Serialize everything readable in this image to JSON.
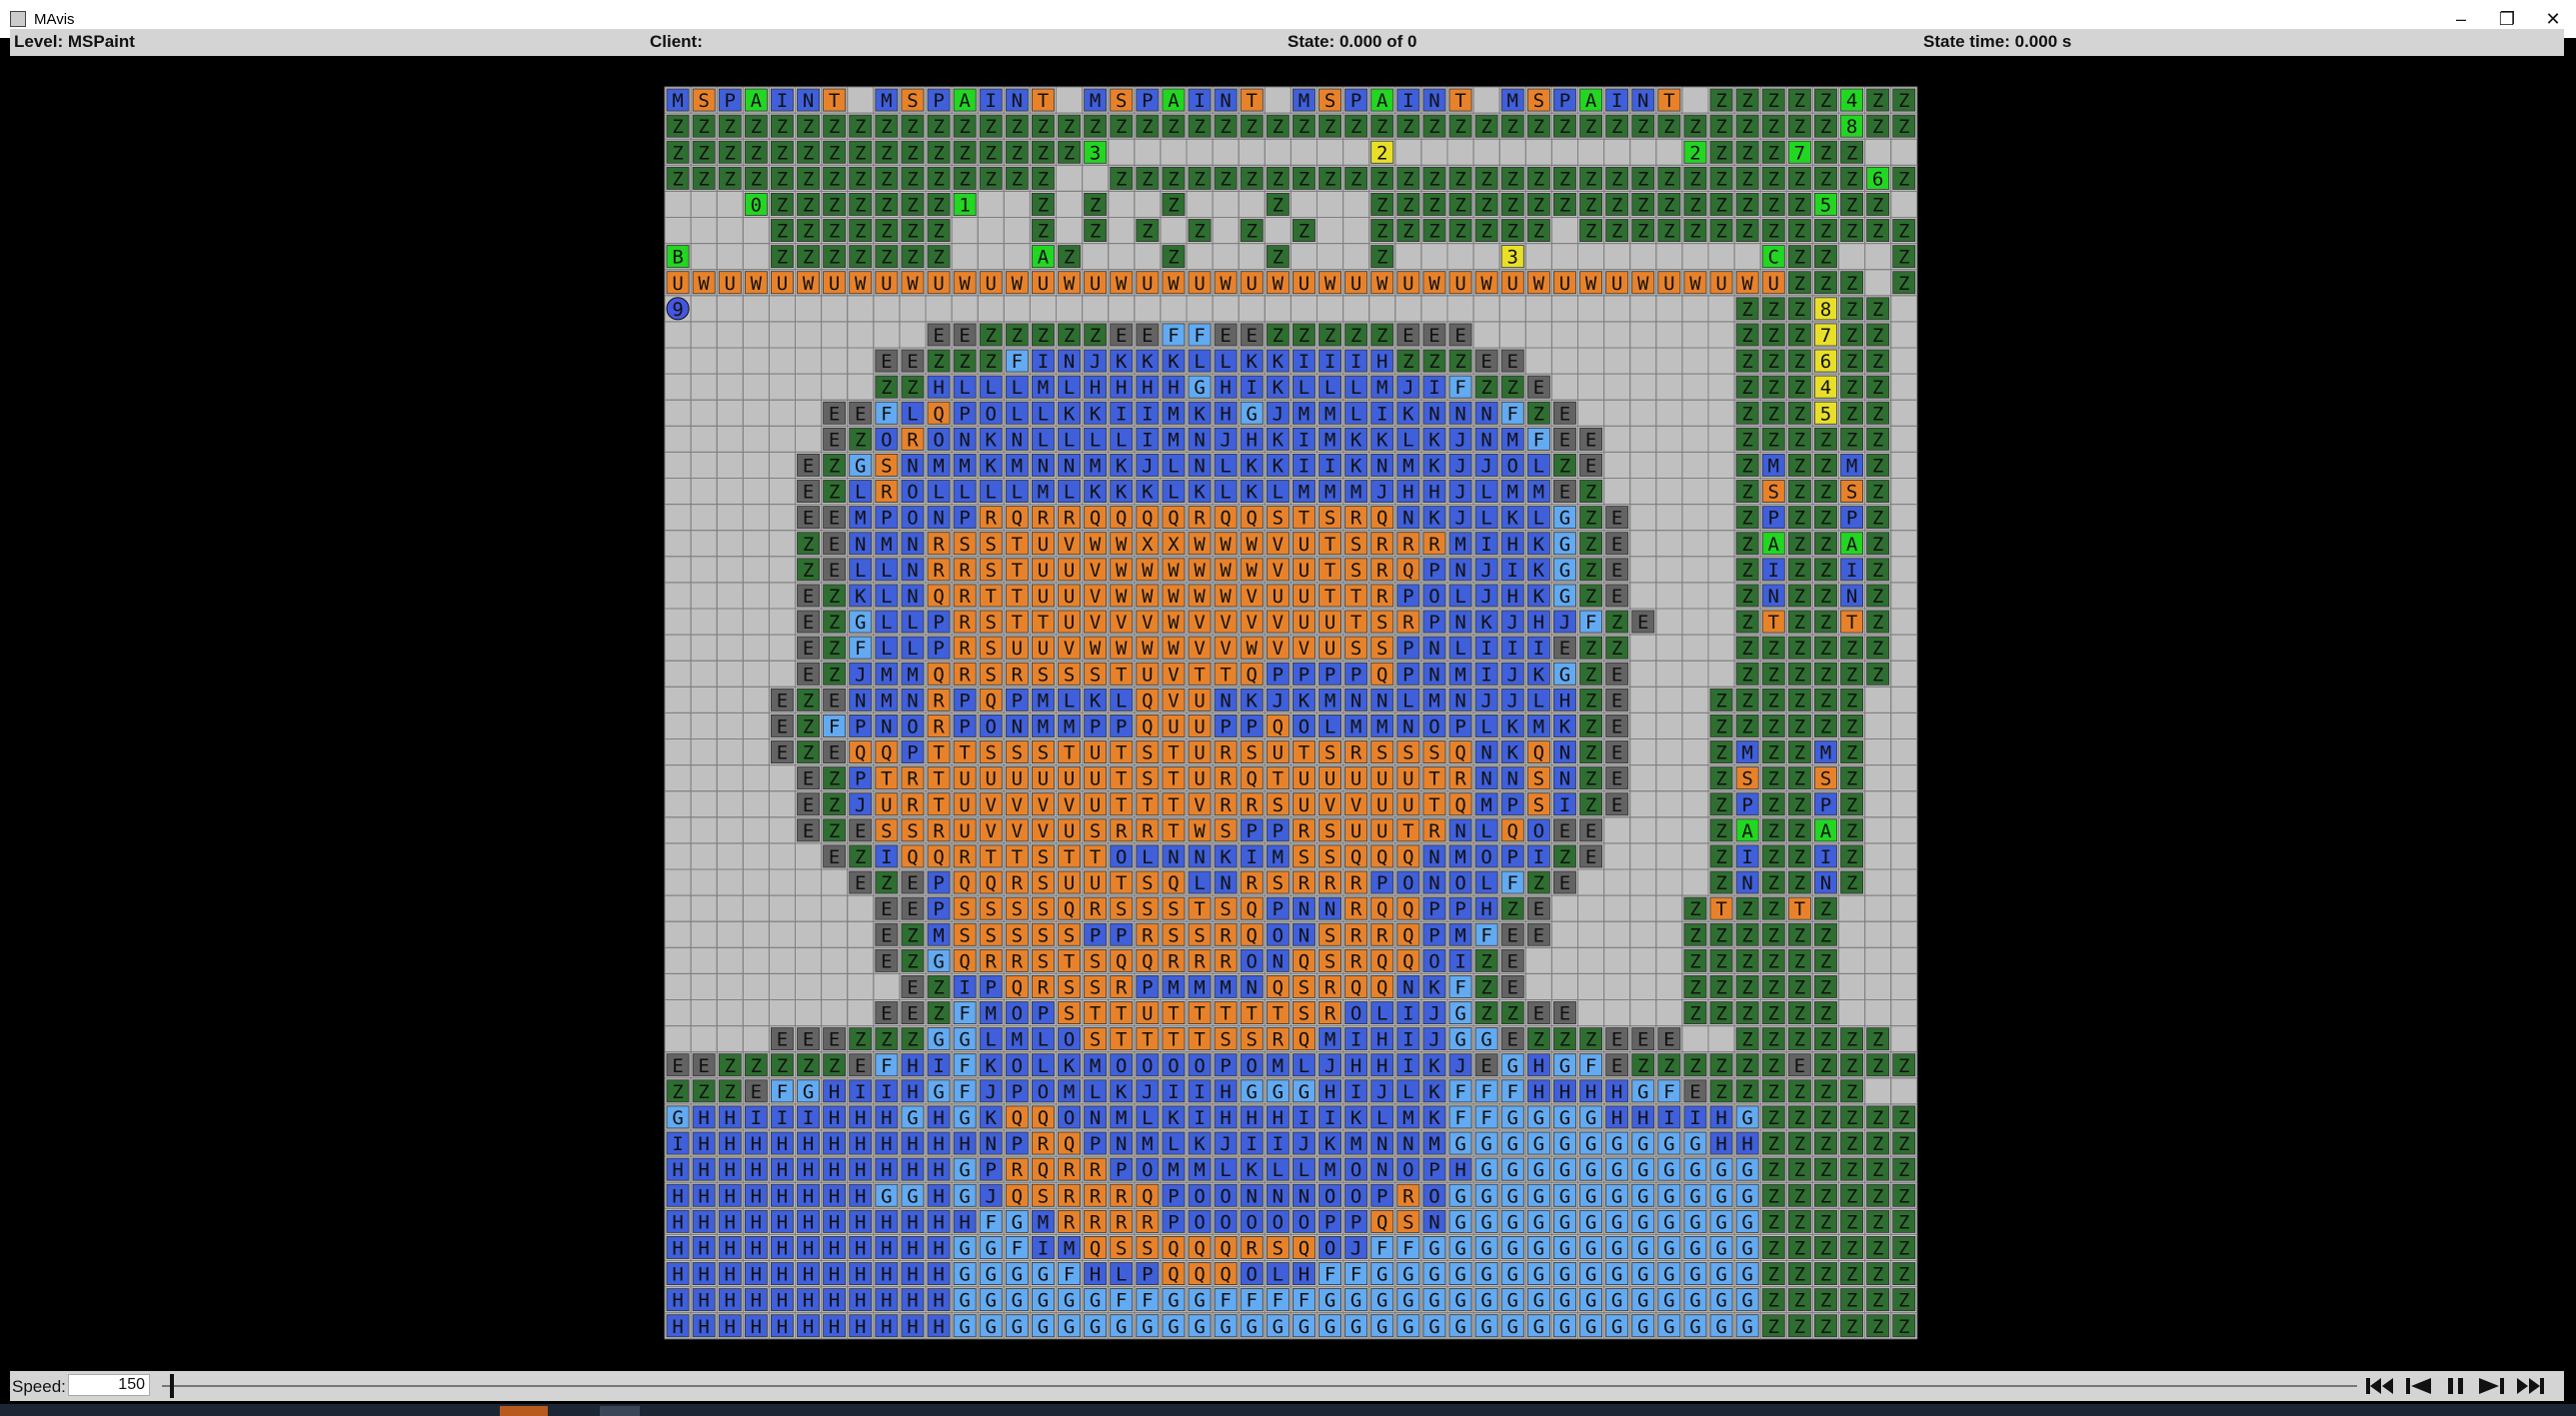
{
  "window": {
    "title": "MAvis"
  },
  "infobar": {
    "level": "Level: MSPaint",
    "client": "Client:",
    "state": "State: 0.000 of 0",
    "state_time": "State time: 0.000 s"
  },
  "bottombar": {
    "speed_label": "Speed:",
    "speed_value": "150"
  },
  "colors": {
    "wall": "#c0c0c0",
    "grid_line": "#808080",
    "dark_box": "#636363",
    "green_box": "#2e6e30",
    "blue_box": "#3f5fdb",
    "orange_box": "#e8822a",
    "light_blue_box": "#62aaf2",
    "agent_green": "#22d622",
    "agent_yellow": "#e8e028",
    "agent_blue": "#4656e0"
  },
  "grid": {
    "rows": [
      "MSPAINT MSPAINT MSPAINT MSPAINT MSPAINT ZZZZZ4ZZ",
      "ZZZZZZZZZZZZZZZZZZZZZZZZZZZZZZZZZZZZZZZZZZZZZ8ZZ",
      "ZZZZZZZZZZZZZZZZ3          2           2ZZZ7ZZ",
      "ZZZZZZZZZZZZZZZ  ZZZZZZZZZZZZZZZZZZZZZZZZZZZZZ6ZZ",
      "   0ZZZZZZZ1  Z Z  Z   Z   ZZZZZZZZZZZZZZZZZ5ZZ",
      "    ZZZZZZZ   Z Z Z Z Z Z  ZZZZZZZ ZZZZZZZZZZZZZ",
      "B   ZZZZZZZ   AZ   Z   Z   Z    3         CZZ  Z",
      "UWUWUWUWUWUWUWUWUWUWUWUWUWUWUWUWUWUWUWUWUWUZZZ ZZ",
      "9                                        ZZZ8ZZ",
      "          EEZZZZZEEFFEEZZZZZEEE          ZZZ7ZZ",
      "        EEZZZFINJKKKLLKKIIIHZZZEE        ZZZ6ZZ",
      "        ZZHLLLMLHHHHGHIKLLLMJIFZZE       ZZZ4ZZ",
      "      EEFLQPOLLKKIIMKHGJMMLIKNNNFZE      ZZZ5ZZ",
      "      EZORONKNLLLLIMNJHKIMKKLKJNMFEE     ZZZZZZ",
      "     EZGSNMMKMNNMKJLNLKKIIKNMKJJOLZE     ZMZZMZ",
      "     EZLROLLLLMLKKKLKLKLMMMJHHJLMMEZ     ZSZZSZ",
      "     EEMPONPRQRRQQQQRQQSTSRQNKJLKLGZE    ZPZZPZ",
      "     ZENMNRSSTUVWWXXWWWVUTSRRRMIHKGZE    ZAZZAZ",
      "     ZELLNRRSTUUVWWWWWWVUTSRQPNJIKGZE    ZIZZIZ",
      "     EZKLNQRTTUUVWWWWWVUUTTRPOLJHKGZE    ZNZZNZ",
      "     EZGLLPRSTTUVVVWVVVVUUTSRPNKJHJFZE   ZTZZTZ",
      "     EZFLLPRSUUVWWWWVVWVVUSSPNLIIIEZZ    ZZZZZZ",
      "     EZJMMQRSRSSSTUVTTQPPPPQPNMIJKGZE    ZZZZZZ",
      "    EZENMNRPQPMLKLQVUNKJKMNNLMNJJLHZE   ZZZZZZ",
      "    EZFPNORPONMMPPQUUPPQOLMMNOPLKMKZE   ZZZZZZ",
      "    EZEQQPTTSSSTUTSTURSUTSRSSSQNKQNZE   ZMZZMZ",
      "     EZPTRTUUUUUUTSTURQTUUUUUTRNNSNZE   ZSZZSZ",
      "     EZJURTUVVVVUTTTVRRSUVVUUTQMPSIZE   ZPZZPZ",
      "     EZESSRUVVVUSRRTWSPPRSUUTRNLQOEE    ZAZZAZ",
      "      EZIQQRTTSTTOLNNKIMSSQQQNMOPIZE    ZIZZIZ",
      "       EZEPQQRSUUTSQLNRSRRRPONOLFZE     ZNZZNZ",
      "        EEPSSSSQRSSSTSQPNNRQQPPHZE     ZTZZTZ",
      "        EZMSSSSSPPRSSRQONSRRQPMFEE     ZZZZZZ",
      "        EZGQRRSTSQQRRRONQSRQQOIZE      ZZZZZZ",
      "         EZIPQRSSRPMMMNQSRQQNKFZE      ZZZZZZ",
      "        EEZFMOPSTTUTTTTTSROLIJGZZEE    ZZZZZZ",
      "    EEEZZZGGLMLOSTTTTSSRQMIHIJGGEZZZEEE  ZZZZZZ",
      "EEZZZZZEFHIFKOLKMOOOOPOMLJHHIKJEGHGFEZZZZZZEZZZZZZ",
      "ZZZEFGHIIHGFJPOMLKJIIHGGGHIJLKFFFHHHHGFEZZZZZZ",
      "GHHIIIHHHGHGKQQONMLKIHHHIIKLMKFFGGGGHHIIHGZZZZZZ",
      "IHHHHHHHHHHHNPRQPNMLKJIIJKMNNMGGGGGGGGGGHHZZZZZZ",
      "HHHHHHHHHHHGPRQRRPOMMLKLLMONOPHGGGGGGGGGGGZZZZZZ",
      "HHHHHHHHGGHGJQSRRRQPOONNNOOPROGGGGGGGGGGGGZZZZZZ",
      "HHHHHHHHHHHHFGMRRRRPOOOOOPPQSNGGGGGGGGGGGGZZZZZZ",
      "HHHHHHHHHHHGGFIMQSSQQQRSQOJFFGGGGGGGGGGGGGZZZZZZ",
      "HHHHHHHHHHHGGGGFHLPQQQOLHFFGGGGGGGGGGGGGGGZZZZZZ",
      "HHHHHHHHHHHGGGGGGFFGGFFFFGGGGGGGGGGGGGGGGGZZZZZZ",
      "HHHHHHHHHHHGGGGGGGGGGGGGGGGGGGGGGGGGGGGGGGZZZZZZ"
    ]
  }
}
